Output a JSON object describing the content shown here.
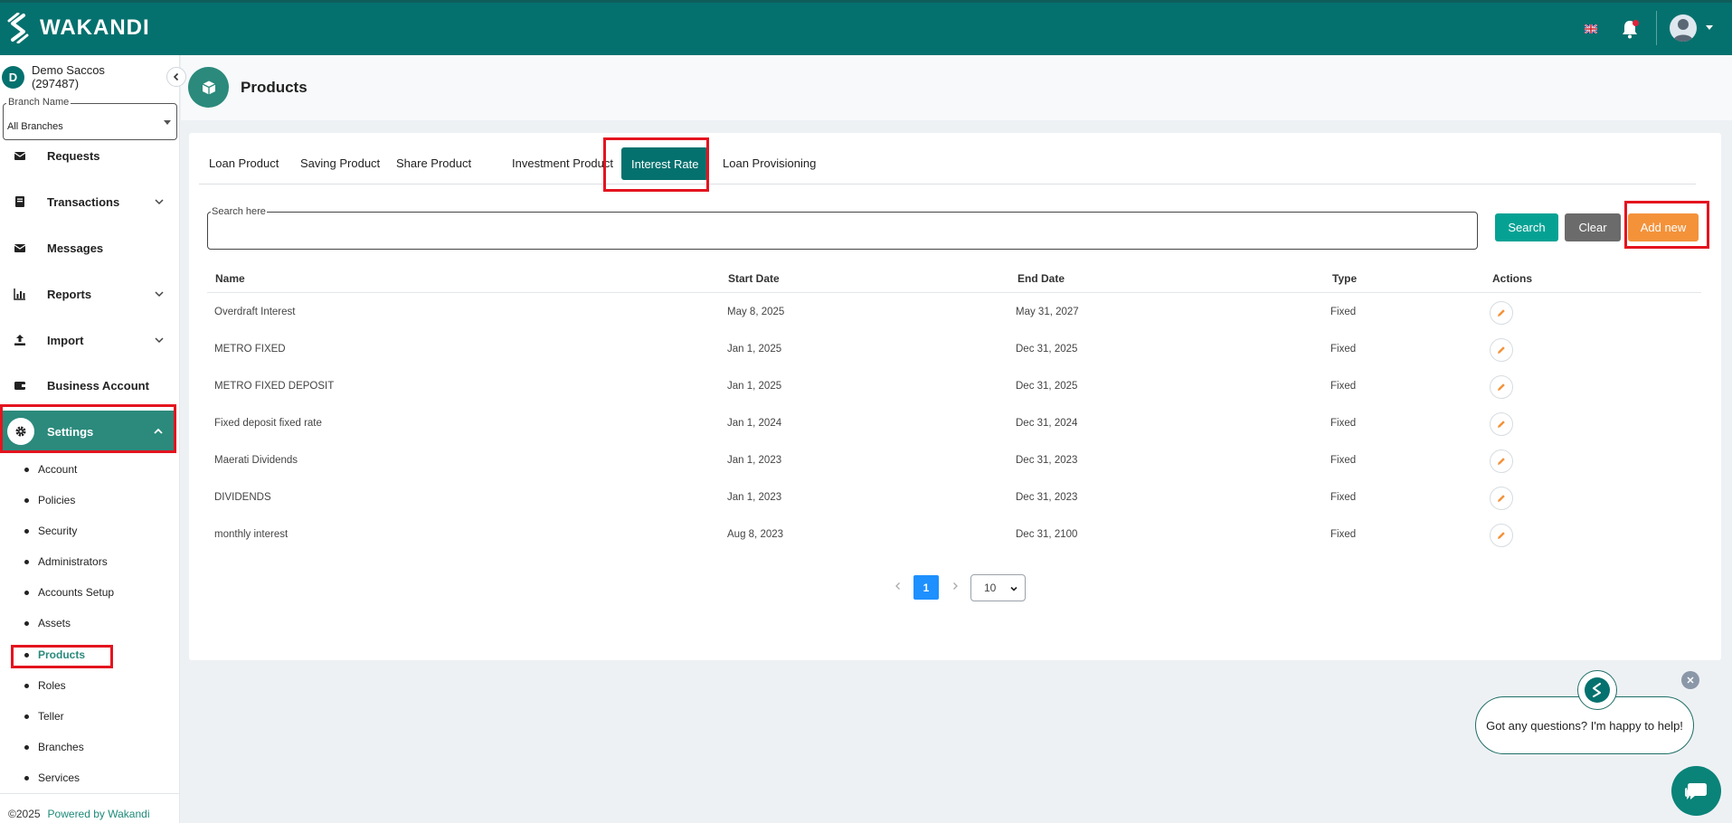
{
  "app": {
    "brand": "WAKANDI"
  },
  "header": {
    "flag_icon": "uk-flag-icon",
    "notification_icon": "bell-icon",
    "avatar_icon": "user-avatar-icon"
  },
  "sidebar": {
    "org_initial": "D",
    "org_name": "Demo Saccos",
    "org_code": "(297487)",
    "branch_label": "Branch Name",
    "branch_value": "All Branches",
    "nav": [
      {
        "label": "Requests"
      },
      {
        "label": "Transactions"
      },
      {
        "label": "Messages"
      },
      {
        "label": "Reports"
      },
      {
        "label": "Import"
      },
      {
        "label": "Business Account"
      },
      {
        "label": "Settings"
      }
    ],
    "settings_sub": [
      "Account",
      "Policies",
      "Security",
      "Administrators",
      "Accounts Setup",
      "Assets",
      "Products",
      "Roles",
      "Teller",
      "Branches",
      "Services"
    ],
    "footer_copy": "©2025",
    "footer_powered": "Powered by Wakandi"
  },
  "page": {
    "title": "Products"
  },
  "tabs": [
    "Loan Product",
    "Saving Product",
    "Share Product",
    "Investment Product",
    "Interest Rate",
    "Loan Provisioning"
  ],
  "search": {
    "label": "Search here",
    "value": "",
    "search_btn": "Search",
    "clear_btn": "Clear",
    "add_btn": "Add new"
  },
  "table": {
    "headers": [
      "Name",
      "Start Date",
      "End Date",
      "Type",
      "Actions"
    ],
    "rows": [
      {
        "name": "Overdraft Interest",
        "start": "May 8, 2025",
        "end": "May 31, 2027",
        "type": "Fixed"
      },
      {
        "name": "METRO FIXED",
        "start": "Jan 1, 2025",
        "end": "Dec 31, 2025",
        "type": "Fixed"
      },
      {
        "name": "METRO FIXED DEPOSIT",
        "start": "Jan 1, 2025",
        "end": "Dec 31, 2025",
        "type": "Fixed"
      },
      {
        "name": "Fixed deposit fixed rate",
        "start": "Jan 1, 2024",
        "end": "Dec 31, 2024",
        "type": "Fixed"
      },
      {
        "name": "Maerati Dividends",
        "start": "Jan 1, 2023",
        "end": "Dec 31, 2023",
        "type": "Fixed"
      },
      {
        "name": "DIVIDENDS",
        "start": "Jan 1, 2023",
        "end": "Dec 31, 2023",
        "type": "Fixed"
      },
      {
        "name": "monthly interest",
        "start": "Aug 8, 2023",
        "end": "Dec 31, 2100",
        "type": "Fixed"
      }
    ]
  },
  "pagination": {
    "current_page": "1",
    "page_size": "10"
  },
  "chat": {
    "message": "Got any questions? I'm happy to help!"
  },
  "colors": {
    "primary": "#05716e",
    "accent": "#f4923a",
    "highlight": "#e4141f"
  }
}
